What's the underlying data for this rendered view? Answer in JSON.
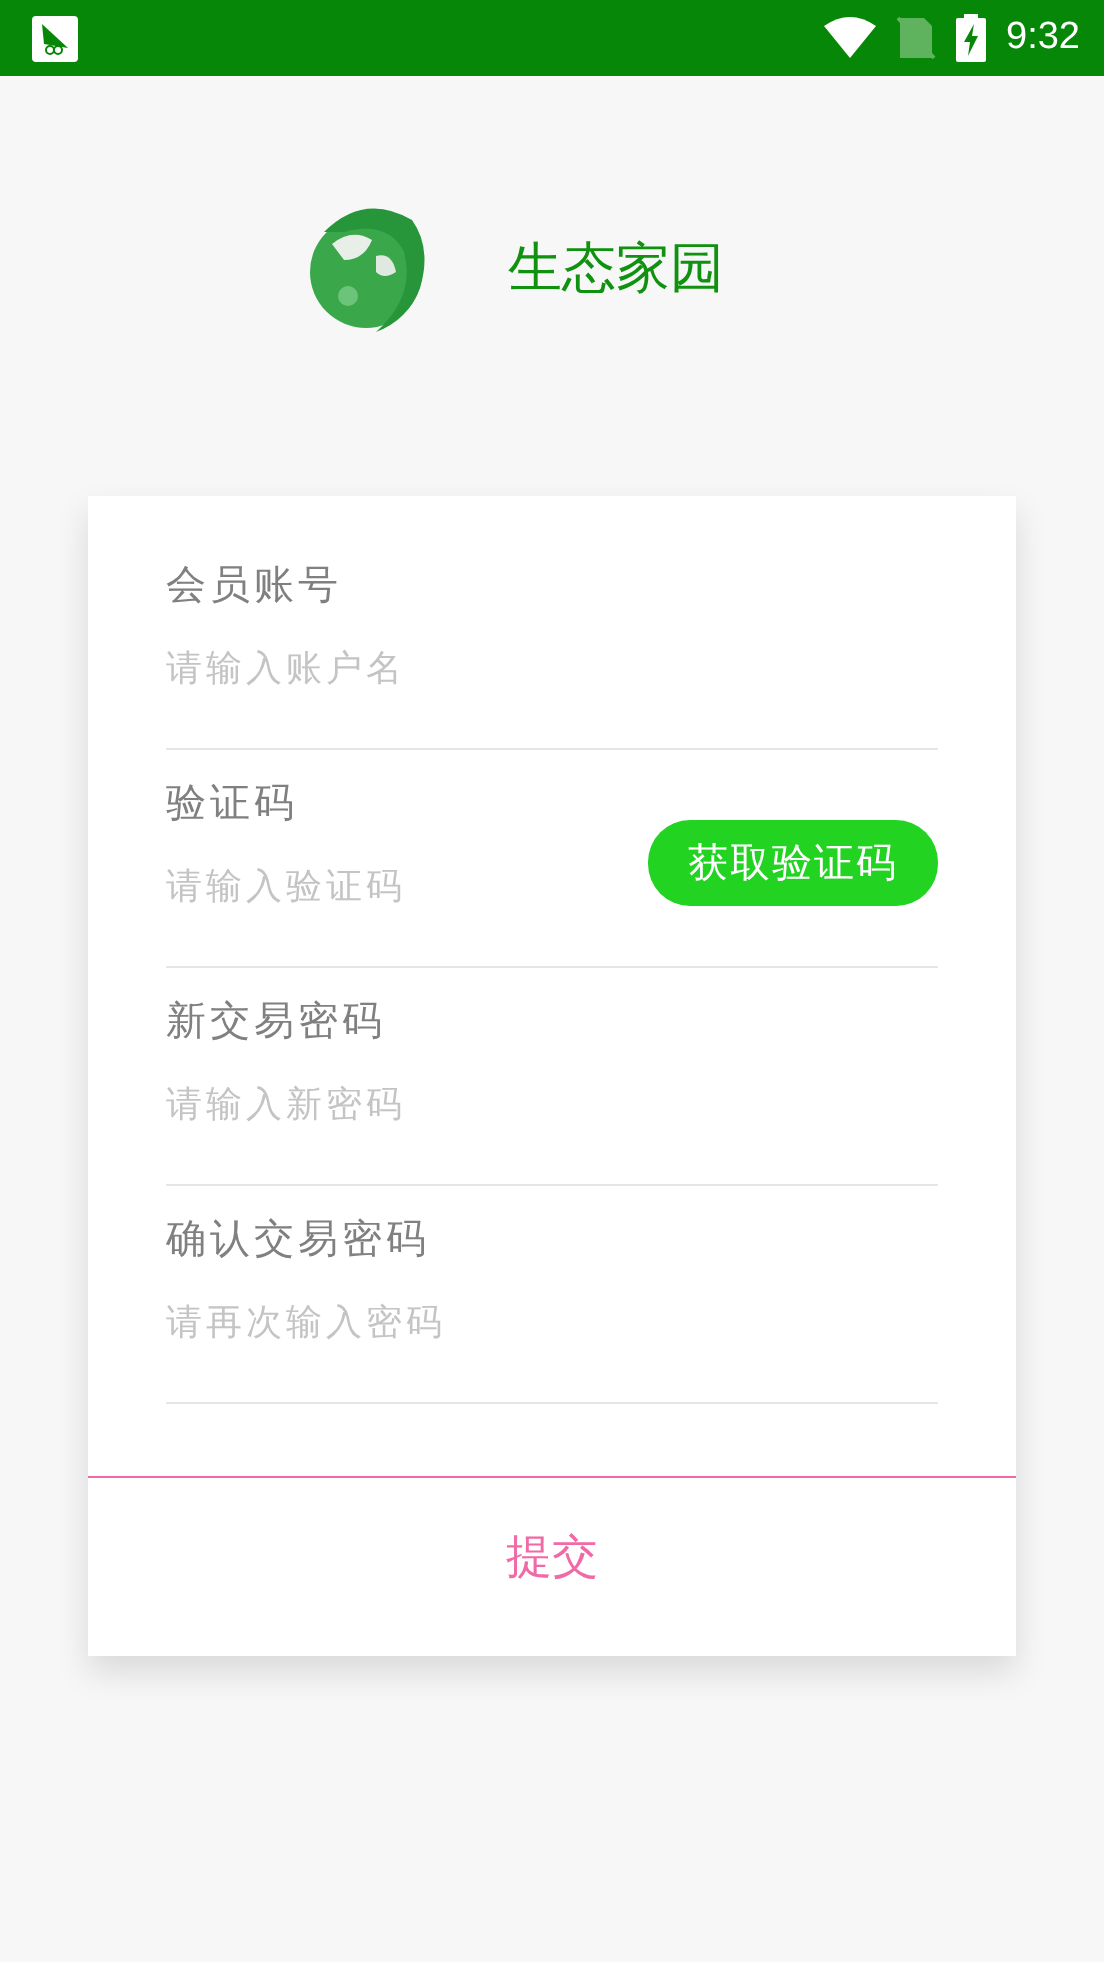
{
  "status_bar": {
    "time": "9:32"
  },
  "header": {
    "title": "生态家园"
  },
  "form": {
    "fields": [
      {
        "kind": "text",
        "label": "会员账号",
        "placeholder": "请输入账户名"
      },
      {
        "kind": "code",
        "label": "验证码",
        "placeholder": "请输入验证码",
        "button": "获取验证码"
      },
      {
        "kind": "text",
        "label": "新交易密码",
        "placeholder": "请输入新密码"
      },
      {
        "kind": "text",
        "label": "确认交易密码",
        "placeholder": "请再次输入密码"
      }
    ],
    "submit": "提交"
  }
}
